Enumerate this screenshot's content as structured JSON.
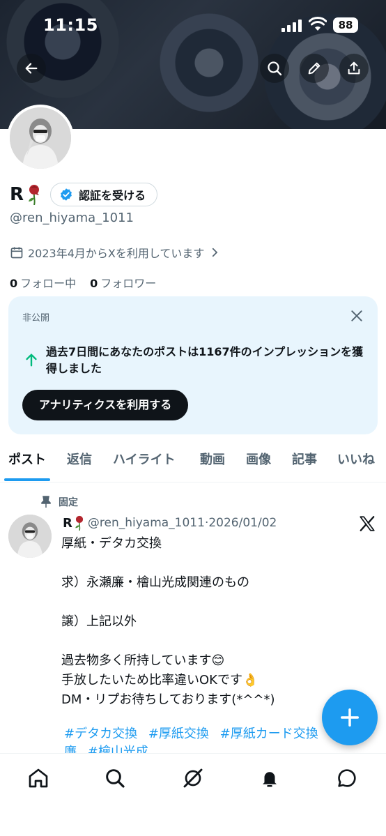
{
  "status_bar": {
    "time": "11:15",
    "battery": "88"
  },
  "profile": {
    "name": "R",
    "verify_label": "認証を受ける",
    "handle": "@ren_hiyama_1011",
    "joined": "2023年4月からXを利用しています",
    "following_count": "0",
    "following_label": "フォロー中",
    "followers_count": "0",
    "followers_label": "フォロワー"
  },
  "private_card": {
    "label": "非公開",
    "text": "過去7日間にあなたのポストは1167件のインプレッションを獲得しました",
    "button": "アナリティクスを利用する"
  },
  "tabs": [
    "ポスト",
    "返信",
    "ハイライト",
    "動画",
    "画像",
    "記事",
    "いいね"
  ],
  "post": {
    "pinned_label": "固定",
    "name": "R",
    "handle_date": "@ren_hiyama_1011·2026/01/02",
    "body": "厚紙・デタカ交換\n\n求）永瀬廉・檜山光成関連のもの\n\n譲）上記以外\n\n過去物多く所持しています😊\n手放したいため比率違いOKです👌\nDM・リプお待ちしております(*^^*)",
    "hashtags": [
      "#デタカ交換",
      "#厚紙交換",
      "#厚紙カード交換",
      "#永瀬廉",
      "#檜山光成"
    ]
  },
  "icons": {
    "back": "arrow-left-icon",
    "search": "search-icon",
    "edit": "pencil-icon",
    "share": "share-icon",
    "calendar": "calendar-icon",
    "close": "close-icon",
    "up_arrow": "arrow-up-icon",
    "pin": "pin-icon",
    "x_logo": "x-logo-icon",
    "compose": "plus-icon",
    "nav": [
      "home-icon",
      "search-icon",
      "grok-icon",
      "notifications-icon",
      "messages-icon"
    ]
  },
  "colors": {
    "accent": "#1d9bf0",
    "text": "#0f1419",
    "secondary": "#536471",
    "card_bg": "#e8f5fd",
    "growth": "#00ba7c"
  }
}
